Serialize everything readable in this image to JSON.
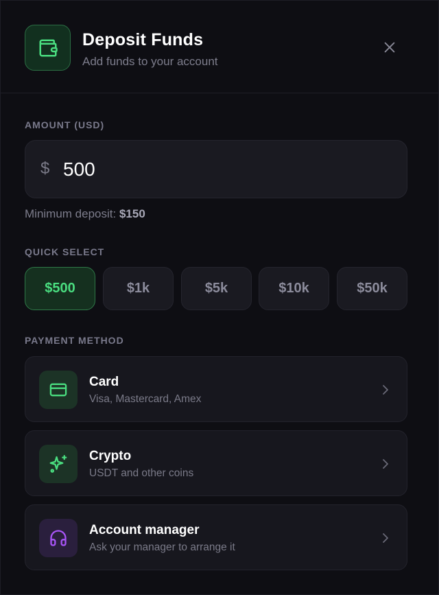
{
  "header": {
    "title": "Deposit Funds",
    "subtitle": "Add funds to your account",
    "icon": "wallet-icon",
    "close_icon": "close-icon"
  },
  "amount": {
    "label": "AMOUNT (USD)",
    "currency_symbol": "$",
    "value": "500",
    "min_deposit_label": "Minimum deposit:",
    "min_deposit_value": "$150"
  },
  "quick_select": {
    "label": "QUICK SELECT",
    "options": [
      "$500",
      "$1k",
      "$5k",
      "$10k",
      "$50k"
    ],
    "selected": "$500"
  },
  "payment": {
    "label": "PAYMENT METHOD",
    "methods": [
      {
        "title": "Card",
        "subtitle": "Visa, Mastercard, Amex",
        "icon": "credit-card-icon"
      },
      {
        "title": "Crypto",
        "subtitle": "USDT and other coins",
        "icon": "sparkles-icon"
      },
      {
        "title": "Account manager",
        "subtitle": "Ask your manager to arrange it",
        "icon": "headphones-icon"
      }
    ]
  },
  "colors": {
    "accent_green": "#4ade80",
    "accent_purple": "#a855f7",
    "background": "#0e0e13"
  }
}
